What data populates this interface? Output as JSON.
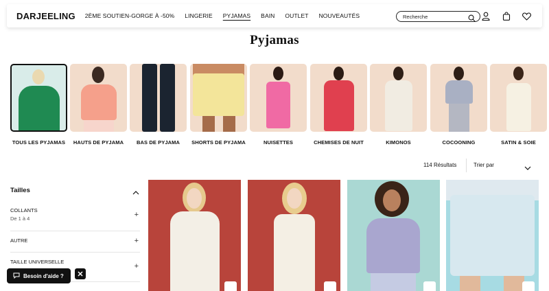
{
  "header": {
    "logo": "DARJEELING",
    "nav": [
      "2ÈME SOUTIEN-GORGE À -50%",
      "LINGERIE",
      "PYJAMAS",
      "BAIN",
      "OUTLET",
      "NOUVEAUTÉS"
    ],
    "active_nav": "PYJAMAS",
    "search_placeholder": "Recherche",
    "icons": [
      "search-icon",
      "account-icon",
      "bag-icon",
      "heart-icon"
    ]
  },
  "page": {
    "title": "Pyjamas"
  },
  "categories": [
    {
      "label": "TOUS LES PYJAMAS",
      "selected": true,
      "bg": "#d9ece9",
      "garment": "#1f8a52"
    },
    {
      "label": "HAUTS DE PYJAMA",
      "selected": false,
      "bg": "#f2dccb",
      "garment": "#f5a08b"
    },
    {
      "label": "BAS DE PYJAMA",
      "selected": false,
      "bg": "#f2dccb",
      "garment": "#1b2430"
    },
    {
      "label": "SHORTS DE PYJAMA",
      "selected": false,
      "bg": "#f2dccb",
      "garment": "#f3e59a"
    },
    {
      "label": "NUISETTES",
      "selected": false,
      "bg": "#f2dccb",
      "garment": "#f06aa4"
    },
    {
      "label": "CHEMISES DE NUIT",
      "selected": false,
      "bg": "#f2dccb",
      "garment": "#e0404f"
    },
    {
      "label": "KIMONOS",
      "selected": false,
      "bg": "#f2dccb",
      "garment": "#f1ece2"
    },
    {
      "label": "COCOONING",
      "selected": false,
      "bg": "#f2dccb",
      "garment": "#a9b0c3"
    },
    {
      "label": "SATIN & SOIE",
      "selected": false,
      "bg": "#f2dccb",
      "garment": "#f6f1e3"
    }
  ],
  "listing": {
    "results": "114 Résultats",
    "sort_label": "Trier par"
  },
  "filters": {
    "section_title": "Tailles",
    "items": [
      {
        "name": "COLLANTS",
        "sub": "De 1 à 4"
      },
      {
        "name": "AUTRE",
        "sub": ""
      },
      {
        "name": "TAILLE UNIVERSELLE",
        "sub": ""
      }
    ]
  },
  "help": {
    "label": "Besoin d'aide ?"
  },
  "products": [
    {
      "bg": "#b8443b",
      "garment": "#f3efe6",
      "hair": "#e6c98d"
    },
    {
      "bg": "#b8443b",
      "garment": "#f4efe4",
      "hair": "#e8cc8e"
    },
    {
      "bg": "#aad8d3",
      "garment": "#a9a6cf",
      "hair": "#3a2418"
    },
    {
      "bg": "#a7dbe3",
      "garment": "#d7e8ef",
      "hair": ""
    }
  ],
  "colors": {
    "accent": "#111111",
    "divider": "#e5e5e5"
  }
}
